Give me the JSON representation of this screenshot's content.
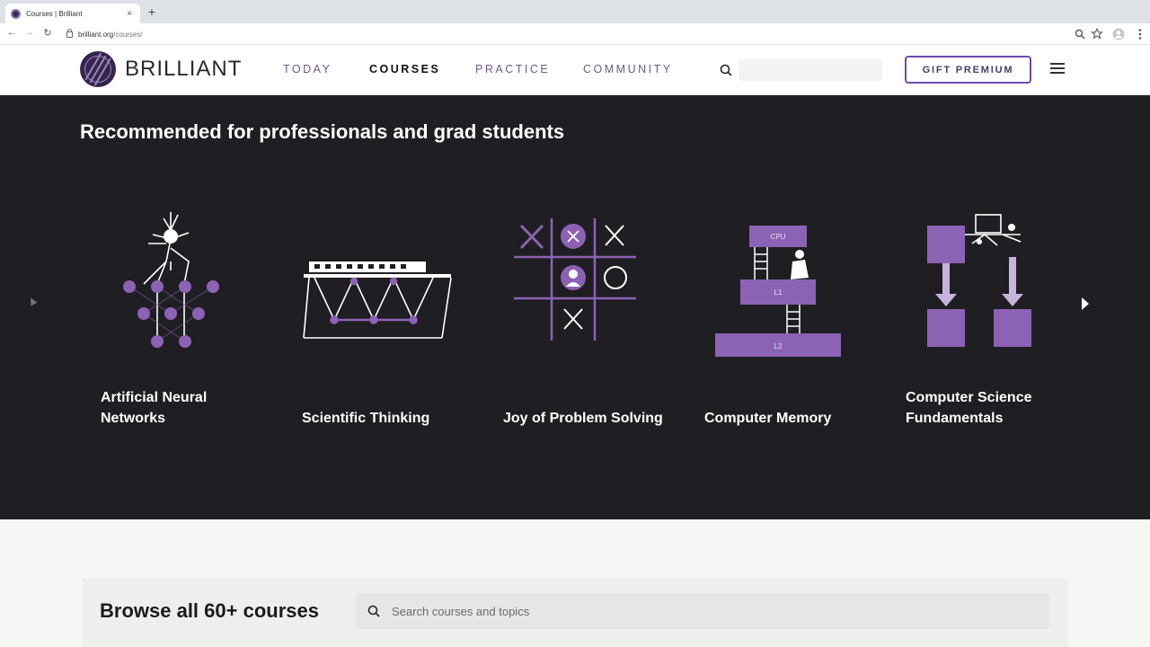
{
  "browser": {
    "tab_title": "Courses | Brilliant",
    "tab_close": "×",
    "new_tab": "+",
    "url_host": "brilliant.org",
    "url_path": "/courses/",
    "back": "←",
    "forward": "→",
    "reload": "↻",
    "icons": [
      "zoom-icon",
      "star-icon",
      "profile-icon",
      "kebab-menu-icon"
    ]
  },
  "header": {
    "logo_text": "BRILLIANT",
    "nav": [
      {
        "label": "TODAY",
        "active": false
      },
      {
        "label": "COURSES",
        "active": true
      },
      {
        "label": "PRACTICE",
        "active": false
      },
      {
        "label": "COMMUNITY",
        "active": false
      }
    ],
    "gift_button": "GIFT PREMIUM",
    "accent_color": "#6c4bb0"
  },
  "recommended": {
    "title": "Recommended for professionals and grad students",
    "courses": [
      {
        "title": "Artificial Neural Networks",
        "icon": "neural-network-illustration"
      },
      {
        "title": "Scientific Thinking",
        "icon": "bridge-illustration"
      },
      {
        "title": "Joy of Problem Solving",
        "icon": "tic-tac-toe-illustration"
      },
      {
        "title": "Computer Memory",
        "icon": "memory-hierarchy-illustration",
        "tags": [
          "CPU",
          "L1",
          "L2"
        ]
      },
      {
        "title": "Computer Science Fundamentals",
        "icon": "flowchart-illustration"
      }
    ],
    "bg_color": "#1f1e22",
    "illustration_color": "#8c62b5"
  },
  "browse": {
    "title": "Browse all 60+ courses",
    "search_placeholder": "Search courses and topics"
  }
}
